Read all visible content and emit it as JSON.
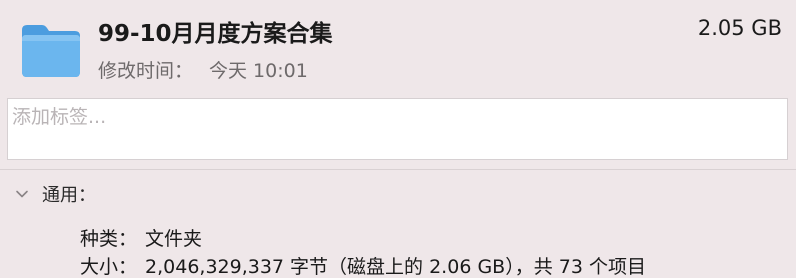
{
  "header": {
    "icon": "folder-icon",
    "title": "99-10月月度方案合集",
    "size": "2.05 GB",
    "modified_label": "修改时间：",
    "modified_value": "今天 10:01"
  },
  "tags": {
    "placeholder": "添加标签...",
    "value": ""
  },
  "general": {
    "title": "通用：",
    "expanded": true,
    "kind_label": "种类：",
    "kind_value": "文件夹",
    "size_label": "大小：",
    "size_value": "2,046,329,337 字节（磁盘上的 2.06 GB），共 73 个项目"
  },
  "colors": {
    "background": "#efe7e9",
    "folder_blue": "#5aa9e6",
    "secondary_text": "#6e6a6b"
  }
}
